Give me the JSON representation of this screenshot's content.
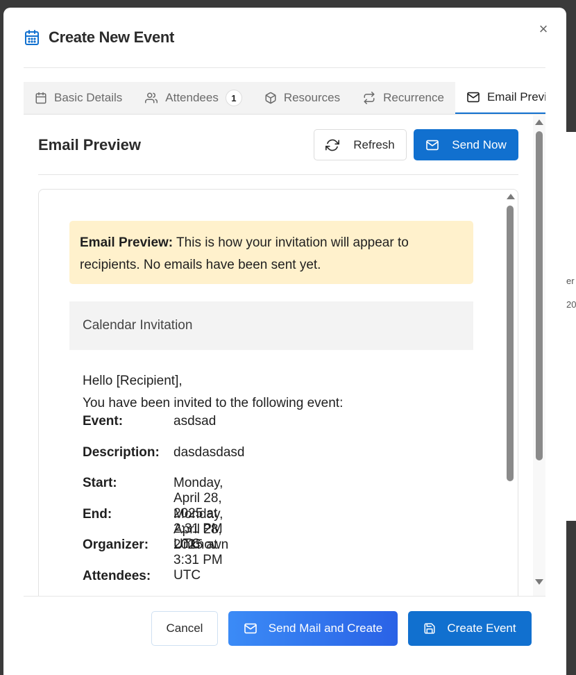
{
  "dialog": {
    "title": "Create New Event",
    "close_glyph": "×"
  },
  "tabs": [
    {
      "label": "Basic Details",
      "icon": "calendar-icon"
    },
    {
      "label": "Attendees",
      "icon": "users-icon",
      "badge": "1"
    },
    {
      "label": "Resources",
      "icon": "box-icon"
    },
    {
      "label": "Recurrence",
      "icon": "repeat-icon"
    },
    {
      "label": "Email Previ",
      "icon": "mail-icon",
      "active": true
    }
  ],
  "email_preview": {
    "heading": "Email Preview",
    "refresh_label": "Refresh",
    "send_now_label": "Send Now",
    "notice_bold": "Email Preview:",
    "notice_text": " This is how your invitation will appear to recipients. No emails have been sent yet.",
    "invite_header": "Calendar Invitation",
    "greeting_line1": "Hello [Recipient],",
    "greeting_line2": "You have been invited to the following event:",
    "details": [
      {
        "label": "Event:",
        "value": "asdsad"
      },
      {
        "label": "Description:",
        "value": "dasdasdasd"
      },
      {
        "label": "Start:",
        "value": "Monday, April 28, 2025 at 2:31 PM UTC"
      },
      {
        "label": "End:",
        "value": "Monday, April 28, 2025 at 3:31 PM UTC"
      },
      {
        "label": "Organizer:",
        "value": "Unknown"
      },
      {
        "label": "Attendees:",
        "value": ""
      }
    ]
  },
  "footer": {
    "cancel_label": "Cancel",
    "send_create_label": "Send Mail and Create",
    "create_label": "Create Event"
  },
  "background": {
    "peek_line1": "er",
    "peek_line2": "20"
  },
  "colors": {
    "primary": "#1170cf",
    "gradient_start": "#3b8bf6",
    "gradient_end": "#2a62e6",
    "notice_bg": "#fff1cc",
    "tab_bar_bg": "#f3f3f3"
  }
}
